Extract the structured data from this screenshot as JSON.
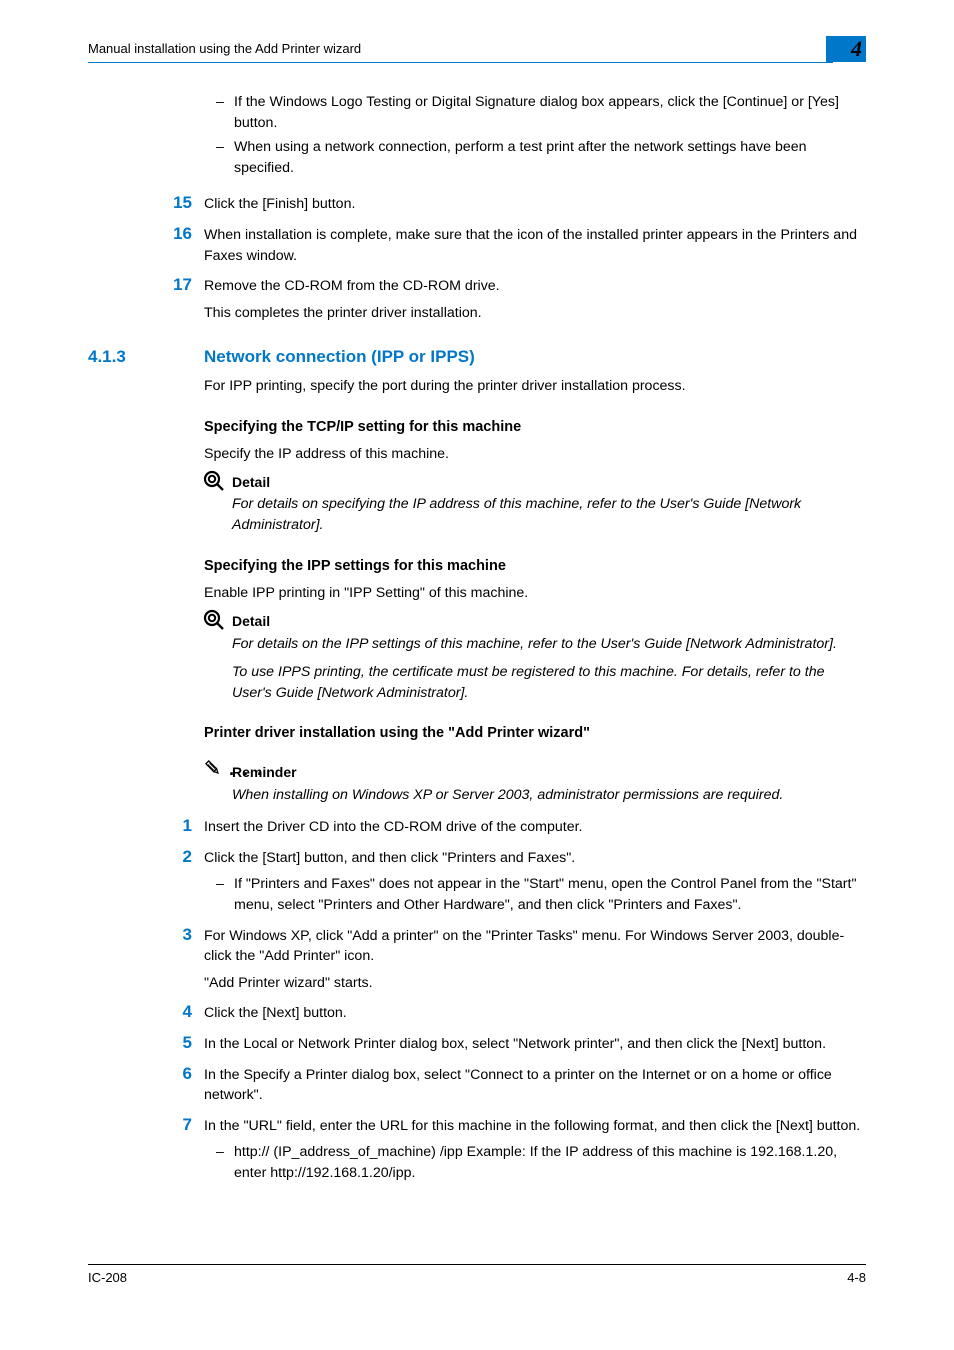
{
  "header": {
    "running_title": "Manual installation using the Add Printer wizard",
    "chapter_number": "4"
  },
  "top_steps": {
    "sub14_a": "If the Windows Logo Testing or Digital Signature dialog box appears, click the [Continue] or [Yes] button.",
    "sub14_b": "When using a network connection, perform a test print after the network settings have been specified.",
    "n15": "15",
    "t15": "Click the [Finish] button.",
    "n16": "16",
    "t16": "When installation is complete, make sure that the icon of the installed printer appears in the Printers and Faxes window.",
    "n17": "17",
    "t17": "Remove the CD-ROM from the CD-ROM drive.",
    "t17_after": "This completes the printer driver installation."
  },
  "section": {
    "number": "4.1.3",
    "title": "Network connection (IPP or IPPS)",
    "intro": "For IPP printing, specify the port during the printer driver installation process.",
    "sub1": "Specifying the TCP/IP setting for this machine",
    "sub1_text": "Specify the IP address of this machine.",
    "detail1_label": "Detail",
    "detail1_text": "For details on specifying the IP address of this machine, refer to the User's Guide [Network Administrator].",
    "sub2": "Specifying the IPP settings for this machine",
    "sub2_text": "Enable IPP printing in \"IPP Setting\" of this machine.",
    "detail2_label": "Detail",
    "detail2_text_a": "For details on the IPP settings of this machine, refer to the User's Guide [Network Administrator].",
    "detail2_text_b": "To use IPPS printing, the certificate must be registered to this machine. For details, refer to the User's Guide [Network Administrator].",
    "sub3": "Printer driver installation using the \"Add Printer wizard\"",
    "reminder_label": "Reminder",
    "reminder_text": "When installing on Windows XP or Server 2003, administrator permissions are required."
  },
  "steps": {
    "n1": "1",
    "t1": "Insert the Driver CD into the CD-ROM drive of the computer.",
    "n2": "2",
    "t2": "Click the [Start] button, and then click \"Printers and Faxes\".",
    "t2_sub": "If \"Printers and Faxes\" does not appear in the \"Start\" menu, open the Control Panel from the \"Start\" menu, select \"Printers and Other Hardware\", and then click \"Printers and Faxes\".",
    "n3": "3",
    "t3": "For Windows XP, click \"Add a printer\" on the \"Printer Tasks\" menu. For Windows Server 2003, double-click the \"Add Printer\" icon.",
    "t3_after": "\"Add Printer wizard\" starts.",
    "n4": "4",
    "t4": "Click the [Next] button.",
    "n5": "5",
    "t5": "In the Local or Network Printer dialog box, select \"Network printer\", and then click the [Next] button.",
    "n6": "6",
    "t6": "In the Specify a Printer dialog box, select \"Connect to a printer on the Internet or on a home or office network\".",
    "n7": "7",
    "t7": "In the \"URL\" field, enter the URL for this machine in the following format, and then click the [Next] button.",
    "t7_sub": "http:// (IP_address_of_machine) /ipp Example: If the IP address of this machine is 192.168.1.20, enter http://192.168.1.20/ipp."
  },
  "footer": {
    "left": "IC-208",
    "right": "4-8"
  }
}
